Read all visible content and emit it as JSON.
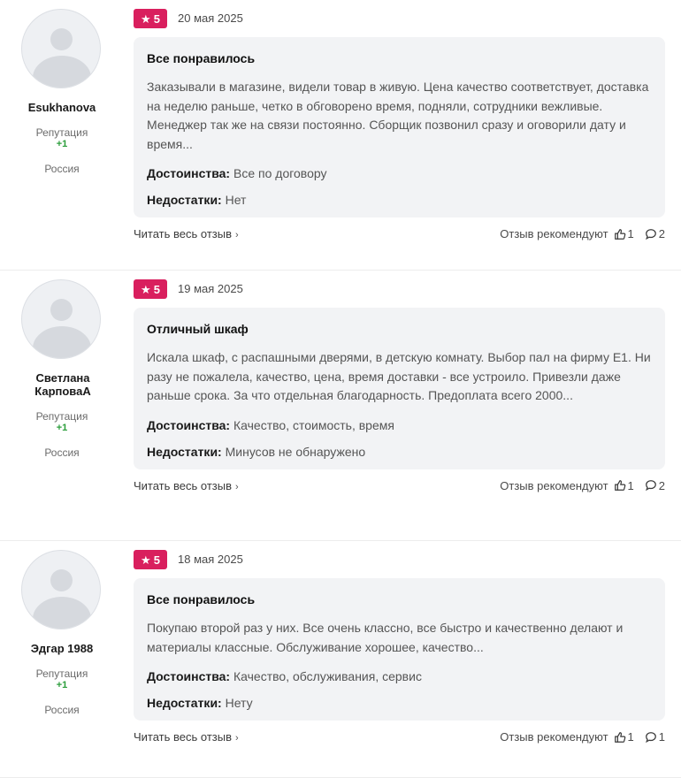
{
  "reviews": [
    {
      "author": "Esukhanova",
      "reputation_label": "Репутация",
      "reputation_value": "+1",
      "country": "Россия",
      "rating": "5",
      "date": "20 мая 2025",
      "title": "Все понравилось",
      "text": "Заказывали в магазине, видели товар в живую. Цена качество соответствует, доставка на неделю раньше, четко в обговорено время, подняли, сотрудники вежливые. Менеджер так же на связи постоянно. Сборщик позвонил сразу и оговорили дату и время...",
      "pros_label": "Достоинства:",
      "pros": "Все по договору",
      "cons_label": "Недостатки:",
      "cons": "Нет",
      "read_more": "Читать весь отзыв",
      "recommend_label": "Отзыв рекомендуют",
      "likes": "1",
      "comments": "2"
    },
    {
      "author": "Светлана КарповаА",
      "reputation_label": "Репутация",
      "reputation_value": "+1",
      "country": "Россия",
      "rating": "5",
      "date": "19 мая 2025",
      "title": "Отличный шкаф",
      "text": "Искала шкаф, с распашными дверями, в детскую комнату. Выбор пал на фирму Е1. Ни разу не пожалела, качество, цена, время доставки - все устроило. Привезли даже раньше срока. За что отдельная благодарность. Предоплата всего 2000...",
      "pros_label": "Достоинства:",
      "pros": "Качество, стоимость, время",
      "cons_label": "Недостатки:",
      "cons": "Минусов не обнаружено",
      "read_more": "Читать весь отзыв",
      "recommend_label": "Отзыв рекомендуют",
      "likes": "1",
      "comments": "2"
    },
    {
      "author": "Эдгар 1988",
      "reputation_label": "Репутация",
      "reputation_value": "+1",
      "country": "Россия",
      "rating": "5",
      "date": "18 мая 2025",
      "title": "Все понравилось",
      "text": "Покупаю второй раз у них. Все очень классно, все быстро и качественно делают и материалы классные. Обслуживание хорошее, качество...",
      "pros_label": "Достоинства:",
      "pros": "Качество, обслуживания, сервис",
      "cons_label": "Недостатки:",
      "cons": "Нету",
      "read_more": "Читать весь отзыв",
      "recommend_label": "Отзыв рекомендуют",
      "likes": "1",
      "comments": "1"
    }
  ],
  "colors": {
    "rating_badge": "#d91f5e",
    "reputation": "#2a9d3a",
    "card_bg": "#f2f3f5"
  },
  "icons": {
    "rating": "star-icon",
    "read_more": "chevron-right-icon",
    "like": "thumbs-up-icon",
    "comment": "comment-bubble-icon"
  }
}
